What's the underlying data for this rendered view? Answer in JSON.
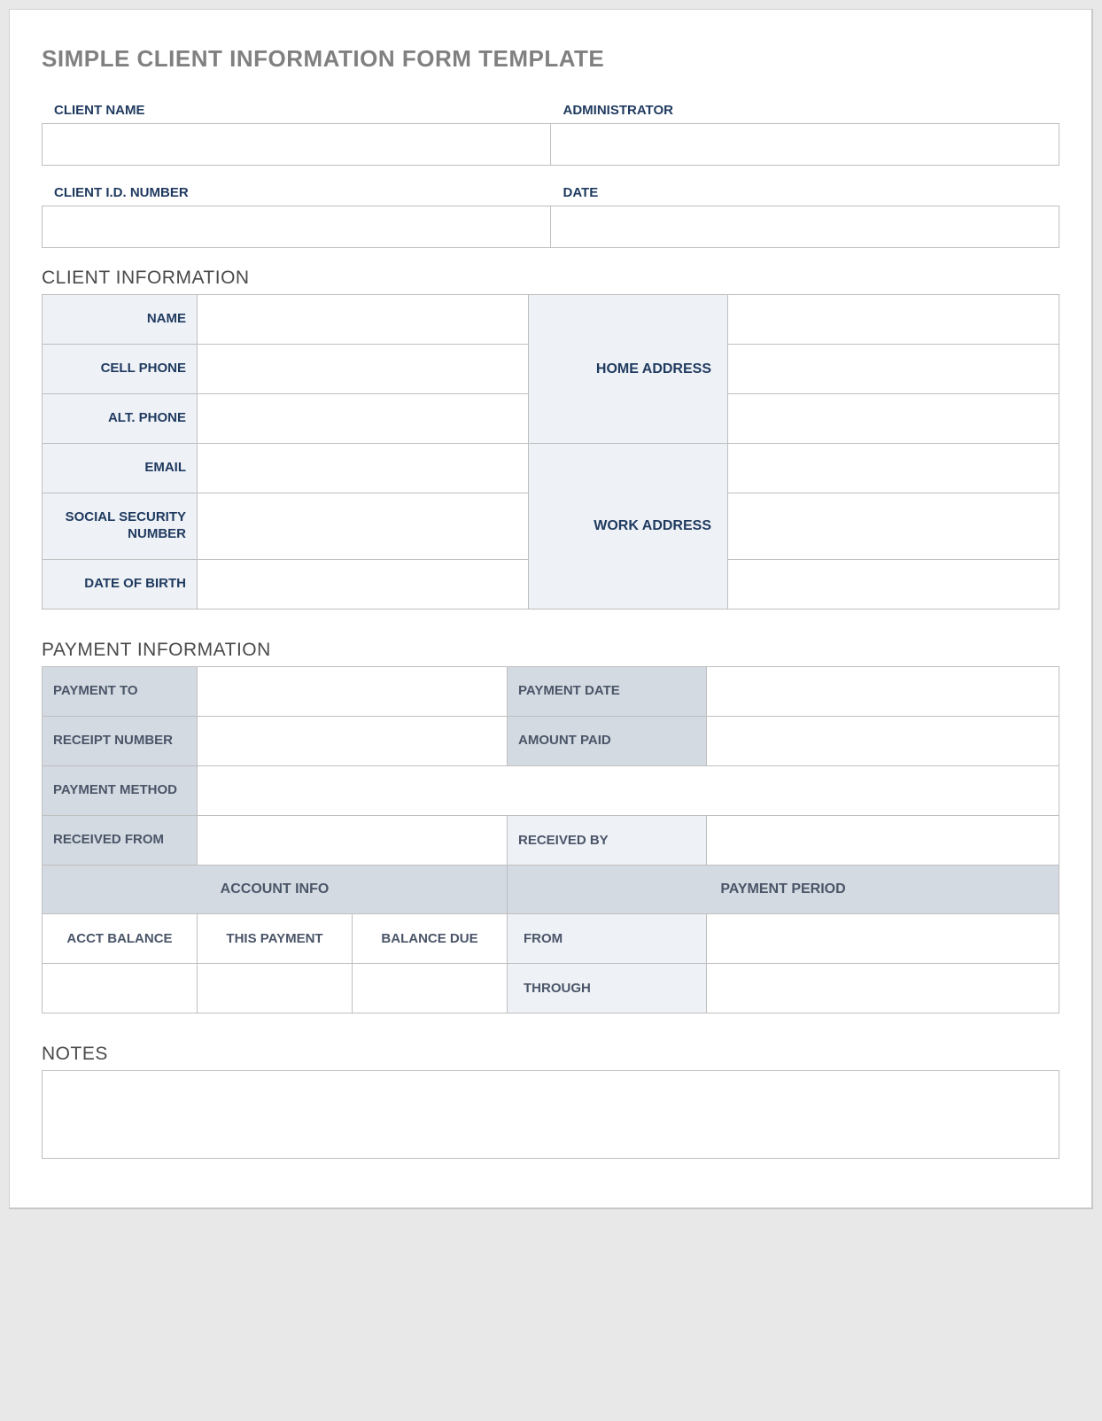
{
  "title": "SIMPLE CLIENT INFORMATION FORM TEMPLATE",
  "header": {
    "client_name_label": "CLIENT NAME",
    "administrator_label": "ADMINISTRATOR",
    "client_id_label": "CLIENT I.D. NUMBER",
    "date_label": "DATE",
    "client_name": "",
    "administrator": "",
    "client_id": "",
    "date": ""
  },
  "client_info": {
    "section_title": "CLIENT INFORMATION",
    "name_label": "NAME",
    "cell_phone_label": "CELL PHONE",
    "alt_phone_label": "ALT. PHONE",
    "email_label": "EMAIL",
    "ssn_label": "SOCIAL SECURITY NUMBER",
    "dob_label": "DATE OF BIRTH",
    "home_address_label": "HOME ADDRESS",
    "work_address_label": "WORK ADDRESS",
    "name": "",
    "cell_phone": "",
    "alt_phone": "",
    "email": "",
    "ssn": "",
    "dob": "",
    "home_address": "",
    "work_address": ""
  },
  "payment_info": {
    "section_title": "PAYMENT INFORMATION",
    "payment_to_label": "PAYMENT TO",
    "payment_date_label": "PAYMENT DATE",
    "receipt_number_label": "RECEIPT NUMBER",
    "amount_paid_label": "AMOUNT PAID",
    "payment_method_label": "PAYMENT METHOD",
    "received_from_label": "RECEIVED FROM",
    "received_by_label": "RECEIVED BY",
    "account_info_label": "ACCOUNT INFO",
    "payment_period_label": "PAYMENT PERIOD",
    "acct_balance_label": "ACCT BALANCE",
    "this_payment_label": "THIS PAYMENT",
    "balance_due_label": "BALANCE DUE",
    "from_label": "FROM",
    "through_label": "THROUGH",
    "payment_to": "",
    "payment_date": "",
    "receipt_number": "",
    "amount_paid": "",
    "payment_method": "",
    "received_from": "",
    "received_by": "",
    "acct_balance": "",
    "this_payment": "",
    "balance_due": "",
    "from": "",
    "through": ""
  },
  "notes": {
    "section_title": "NOTES",
    "value": ""
  }
}
